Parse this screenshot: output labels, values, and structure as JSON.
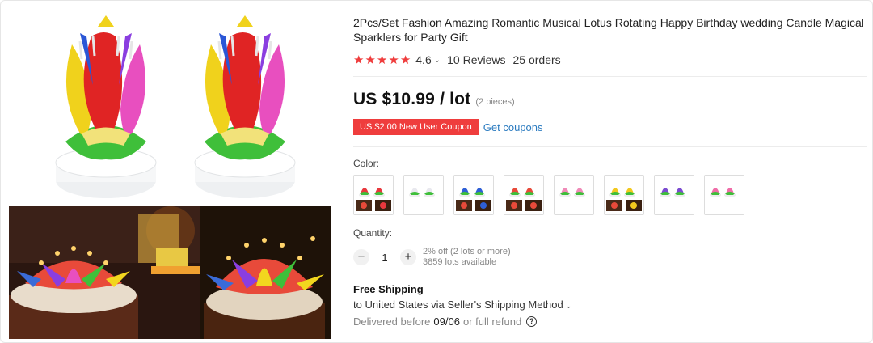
{
  "product": {
    "title": "2Pcs/Set Fashion Amazing Romantic Musical Lotus Rotating Happy Birthday wedding Candle Magical Sparklers for Party Gift",
    "rating": "4.6",
    "reviews": "10 Reviews",
    "orders": "25 orders",
    "price": "US $10.99 / lot",
    "price_note": "(2 pieces)",
    "coupon": "US $2.00 New User Coupon",
    "get_coupons": "Get coupons",
    "stars_filled": 5
  },
  "gallery": {
    "images": [
      {
        "name": "lotus-candle-colorful",
        "icon": "lotus-candle-icon"
      },
      {
        "name": "lotus-candle-colorful-2",
        "icon": "lotus-candle-icon"
      },
      {
        "name": "lotus-candle-on-cake",
        "icon": "cake-photo-icon"
      },
      {
        "name": "lotus-candle-on-cake-2",
        "icon": "cake-photo-icon"
      }
    ]
  },
  "options": {
    "color_label": "Color:",
    "swatches": [
      {
        "name": "red",
        "petal": "#e8383d"
      },
      {
        "name": "white",
        "petal": "#e8e8ee"
      },
      {
        "name": "blue",
        "petal": "#2e5fd6"
      },
      {
        "name": "multicolor-cake",
        "petal": "#e84a3a"
      },
      {
        "name": "pink",
        "petal": "#f08ab8"
      },
      {
        "name": "yellow",
        "petal": "#f2c81e"
      },
      {
        "name": "purple",
        "petal": "#7b4bd0"
      },
      {
        "name": "pink-white",
        "petal": "#f06ca8"
      }
    ],
    "quantity_label": "Quantity:",
    "quantity_value": "1",
    "quantity_minus": "−",
    "quantity_plus": "+",
    "discount_note": "2% off (2 lots or more)",
    "stock_note": "3859 lots available"
  },
  "shipping": {
    "title": "Free Shipping",
    "destination": "to United States via Seller's Shipping Method",
    "delivered_prefix": "Delivered before",
    "delivered_date": "09/06",
    "delivered_suffix": "or full refund",
    "help_glyph": "?"
  },
  "colors": {
    "star": "#ef3c3c",
    "coupon_bg": "#ef3d3d",
    "link": "#2b7bc0"
  }
}
